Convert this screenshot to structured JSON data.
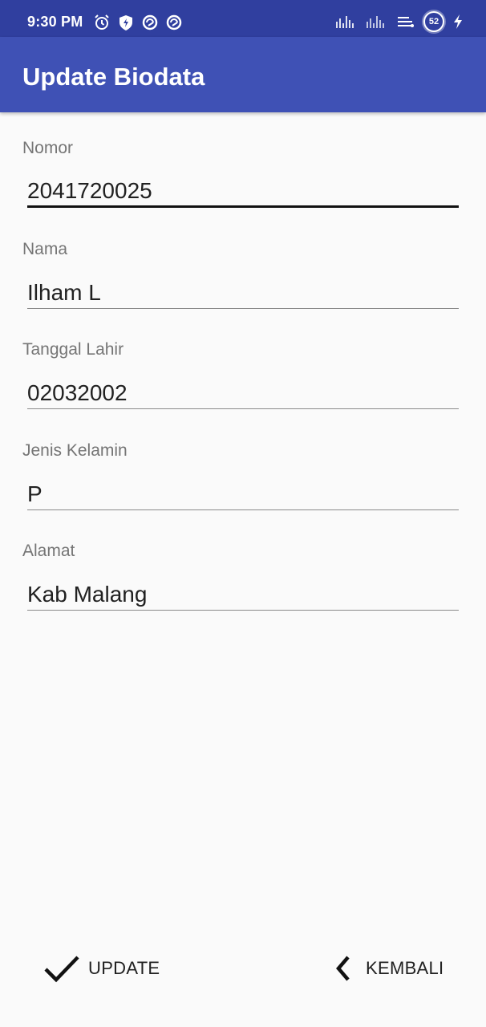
{
  "status_bar": {
    "time": "9:30 PM",
    "left_icons": [
      "alarm-icon",
      "shield-icon",
      "sync-icon",
      "sync-icon"
    ],
    "right_icons": [
      "signal-icon",
      "signal-icon",
      "data-icon"
    ],
    "battery": "52",
    "charging_icon": "bolt-icon"
  },
  "app_bar": {
    "title": "Update Biodata",
    "color": "#3f51b5",
    "status_color": "#303f9f"
  },
  "form": {
    "nomor": {
      "label": "Nomor",
      "value": "2041720025"
    },
    "nama": {
      "label": "Nama",
      "value": "Ilham L"
    },
    "tanggal_lahir": {
      "label": "Tanggal Lahir",
      "value": "02032002"
    },
    "jenis_kelamin": {
      "label": "Jenis Kelamin",
      "value": "P"
    },
    "alamat": {
      "label": "Alamat",
      "value": "Kab Malang"
    }
  },
  "actions": {
    "update_label": "UPDATE",
    "update_icon": "check-icon",
    "kembali_label": "KEMBALI",
    "kembali_icon": "chevron-left-icon"
  }
}
